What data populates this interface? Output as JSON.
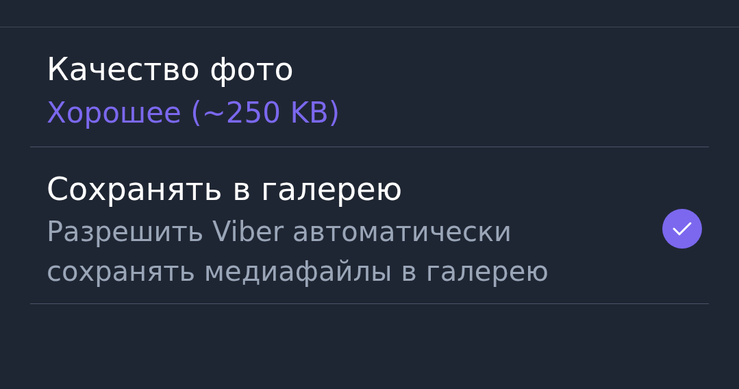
{
  "settings": [
    {
      "kind": "value",
      "title": "Качество фото",
      "value": "Хорошее (~250 KB)"
    },
    {
      "kind": "checkbox",
      "title": "Сохранять в галерею",
      "description": "Разрешить Viber автоматически сохранять медиафайлы в галерею",
      "checked": true
    }
  ]
}
